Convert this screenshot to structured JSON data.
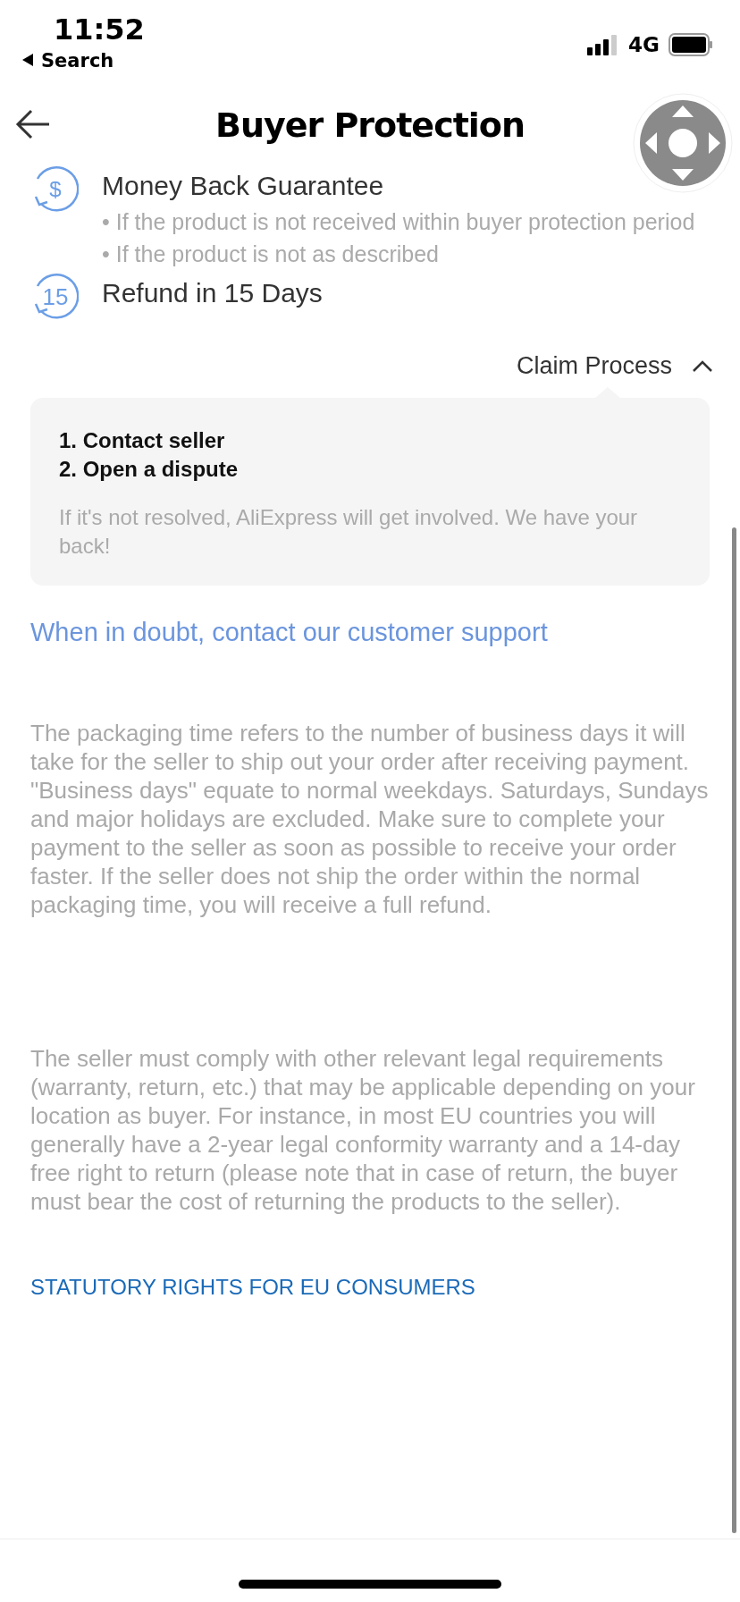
{
  "status_bar": {
    "time": "11:52",
    "back_app": "Search",
    "network": "4G"
  },
  "header": {
    "title": "Buyer Protection"
  },
  "guarantees": [
    {
      "kind": "money",
      "icon_text": "$",
      "title": "Money Back Guarantee",
      "bullets": [
        "• If the product is not received within buyer protection period",
        "• If the product is not as described"
      ]
    },
    {
      "kind": "days",
      "icon_text": "15",
      "title": "Refund in 15 Days"
    }
  ],
  "claim_process": {
    "label": "Claim Process",
    "expanded": true,
    "steps": [
      "1. Contact seller",
      "2. Open a dispute"
    ],
    "note": "If it's not resolved, AliExpress will get involved. We have your back!"
  },
  "support_link": "When in doubt, contact our customer support",
  "paragraphs": [
    "The packaging time refers to the number of business days it will take for the seller to ship out your order after receiving payment. \"Business days\" equate to normal weekdays. Saturdays, Sundays and major holidays are excluded. Make sure to complete your payment to the seller as soon as possible to receive your order faster. If the seller does not ship the order within the normal packaging time, you will receive a full refund.",
    "The seller must comply with other relevant legal requirements (warranty, return, etc.) that may be applicable depending on your location as buyer. For instance, in most EU countries you will generally have a 2-year legal conformity warranty and a 14-day free right to return (please note that in case of return, the buyer must bear the cost of returning the products to the seller)."
  ],
  "eu_link": "STATUTORY RIGHTS FOR EU CONSUMERS"
}
